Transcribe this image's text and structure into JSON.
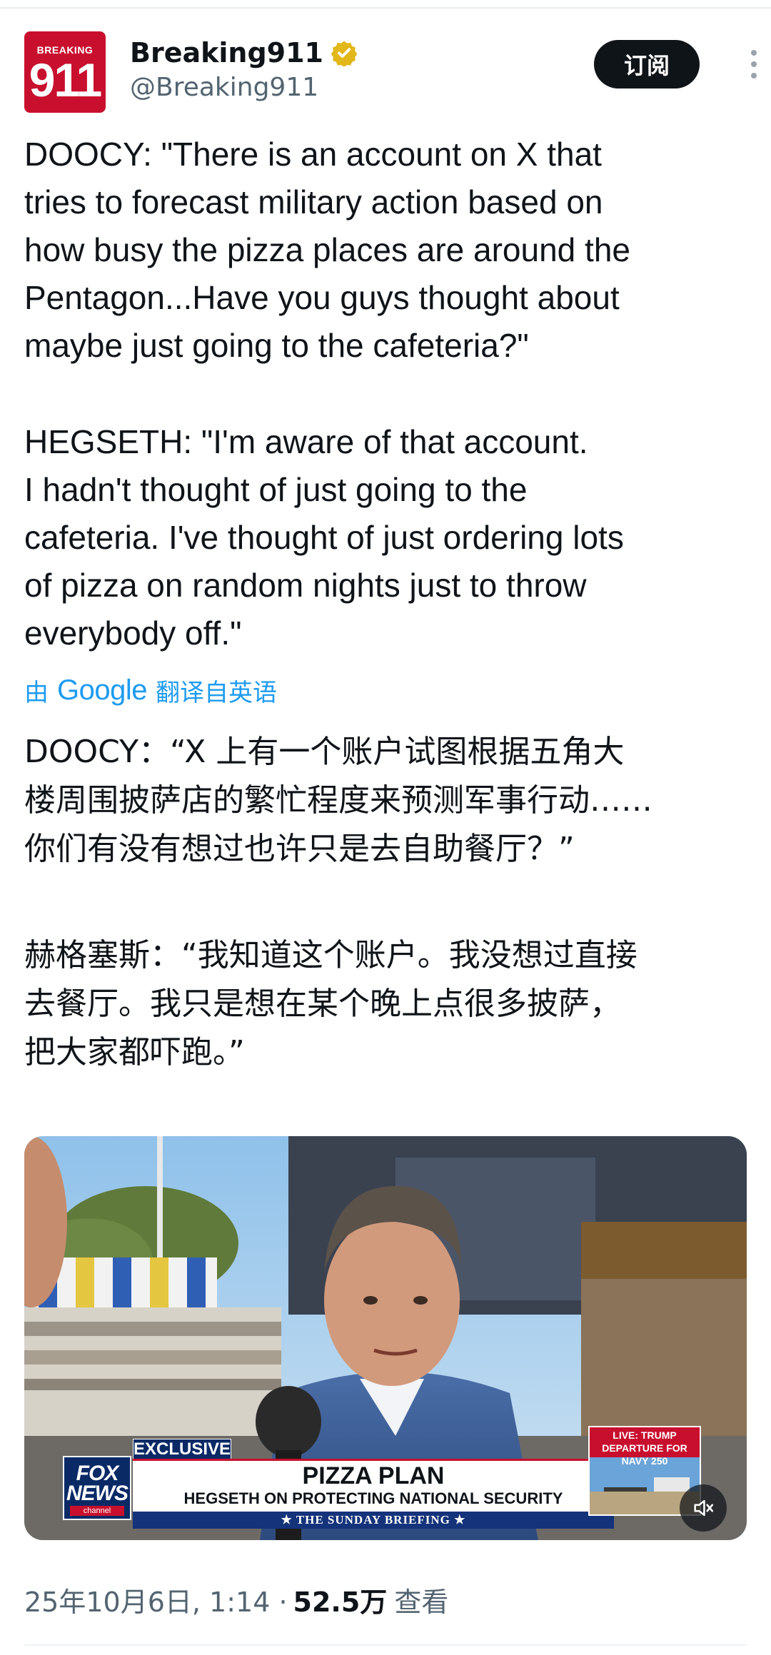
{
  "account": {
    "name": "Breaking911",
    "handle": "@Breaking911",
    "avatar_top": "BREAKING",
    "avatar_main": "911",
    "subscribe_label": "订阅"
  },
  "post": {
    "paragraph1": [
      "DOOCY: \"There is an account on X that",
      "tries to forecast military action based on",
      "how busy the pizza places are around the",
      "Pentagon...Have you guys thought about",
      "maybe just going to the cafeteria?\""
    ],
    "paragraph2": [
      "HEGSETH: \"I'm aware of that account.",
      "I hadn't thought of just going to the",
      "cafeteria. I've thought of just ordering lots",
      "of pizza on random nights just to throw",
      "everybody off.\""
    ]
  },
  "translation": {
    "prefix": "由",
    "brand": "Google",
    "suffix": "翻译自英语",
    "paragraph1": [
      "DOOCY：“X 上有一个账户试图根据五角大",
      "楼周围披萨店的繁忙程度来预测军事行动……",
      "你们有没有想过也许只是去自助餐厅？”"
    ],
    "paragraph2": [
      "赫格塞斯：“我知道这个账户。我没想过直接",
      "去餐厅。我只是想在某个晚上点很多披萨，",
      "把大家都吓跑。”"
    ]
  },
  "video": {
    "exclusive_label": "EXCLUSIVE",
    "headline": "PIZZA PLAN",
    "subheadline": "HEGSETH ON PROTECTING NATIONAL SECURITY",
    "show_strip": "★ THE SUNDAY BRIEFING ★",
    "network_line1": "FOX",
    "network_line2": "NEWS",
    "network_line3": "channel",
    "live_label": "LIVE: TRUMP DEPARTURE FOR NAVY 250"
  },
  "meta": {
    "timestamp": "25年10月6日, 1:14 ·",
    "views_count": "52.5万",
    "views_label": "查看"
  },
  "colors": {
    "link_blue": "#1d9bf0",
    "verified_gold": "#e2b719",
    "fox_red": "#c8102e",
    "fox_navy": "#0a2a66"
  }
}
